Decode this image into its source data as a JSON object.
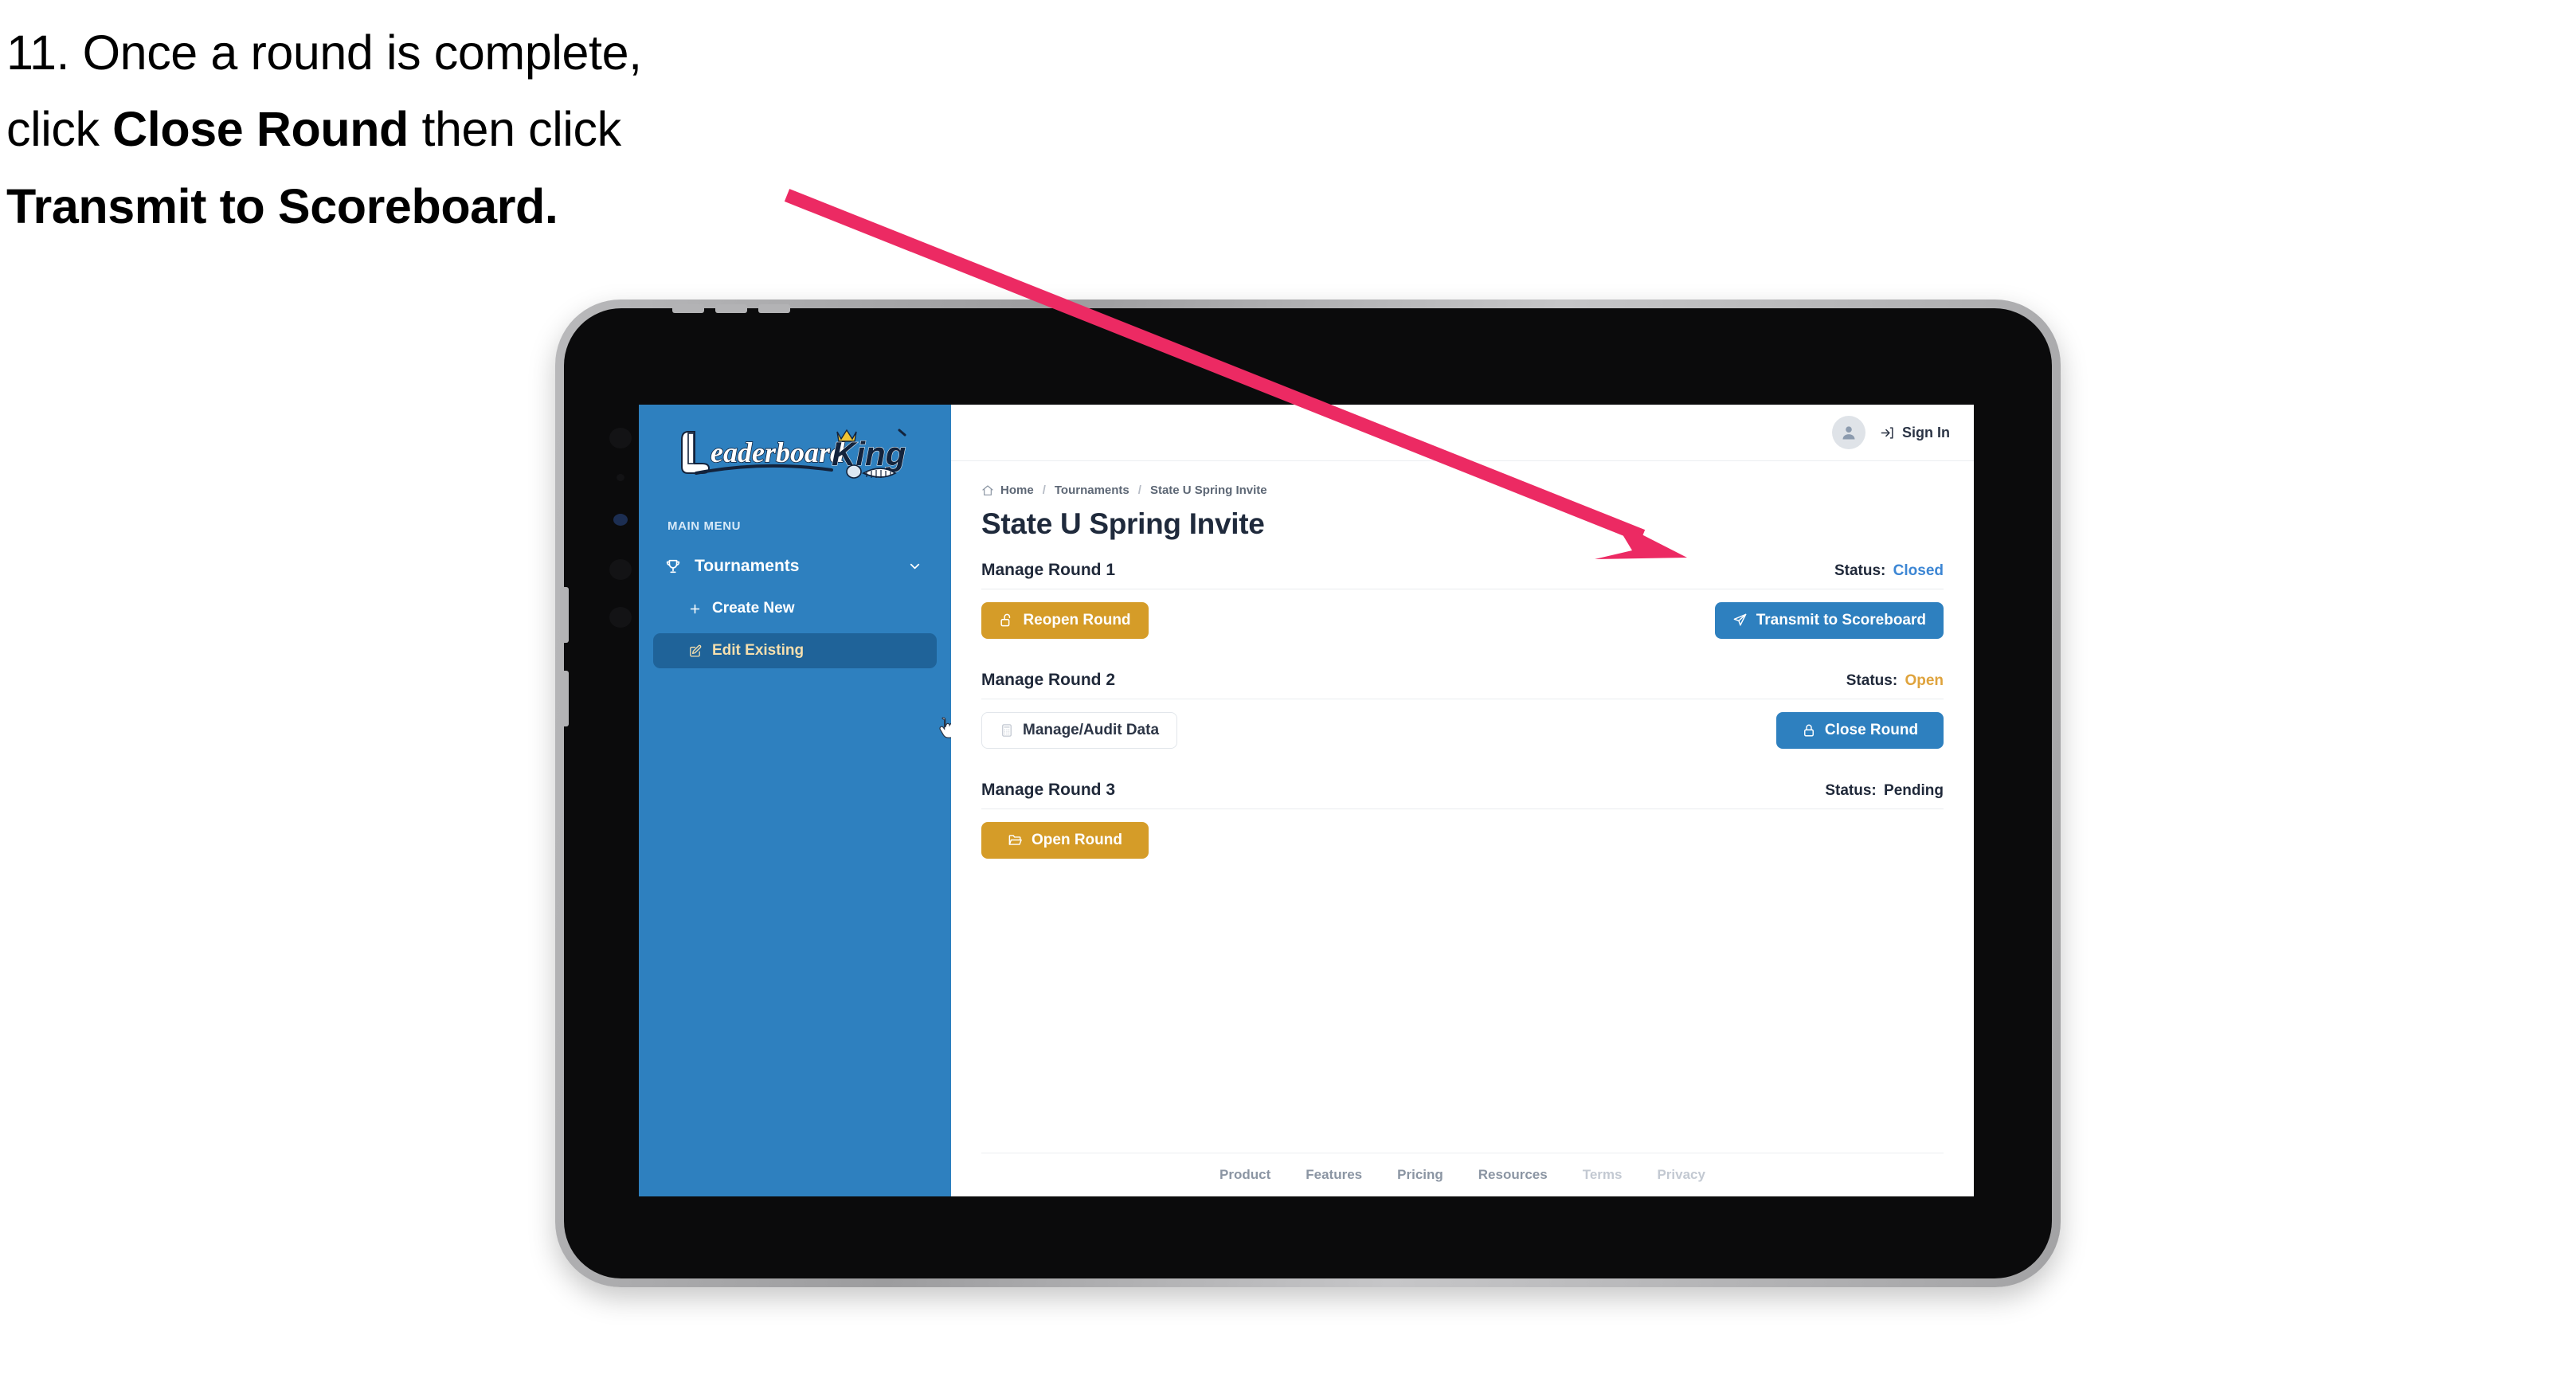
{
  "caption": {
    "line1_plain": "11. Once a round is complete,",
    "line2_pre": "click ",
    "line2_bold": "Close Round",
    "line2_post": " then click",
    "line3_bold": "Transmit to Scoreboard."
  },
  "colors": {
    "accent_blue": "#2e80bf",
    "accent_gold": "#d59c28",
    "sidebar_blue": "#2e80bf",
    "sidebar_active": "#1f6399",
    "status_closed": "#3c86d4",
    "status_open": "#dfa33c",
    "status_pending": "#20293a",
    "annotation_pink": "#ec2a63",
    "heading_navy": "#1f2a3c"
  },
  "app": {
    "sidebar": {
      "logo_primary": "Leaderboard",
      "logo_secondary": "King",
      "menu_label": "MAIN MENU",
      "items": [
        {
          "label": "Tournaments",
          "icon": "trophy-icon",
          "chevron": "chevron-down-icon",
          "active": false
        },
        {
          "label": "Create New",
          "icon": "plus-icon",
          "active": false
        },
        {
          "label": "Edit Existing",
          "icon": "edit-pencil-icon",
          "active": true
        }
      ]
    },
    "topbar": {
      "avatar_icon": "user-avatar-icon",
      "signin_label": "Sign In",
      "signin_icon": "login-arrow-icon"
    },
    "breadcrumb": {
      "home_icon": "home-icon",
      "items": [
        "Home",
        "Tournaments",
        "State U Spring Invite"
      ],
      "separator": "/"
    },
    "page_title": "State U Spring Invite",
    "rounds": [
      {
        "name": "Manage Round 1",
        "status_label": "Status:",
        "status_value": "Closed",
        "status_color": "#3c86d4",
        "left_button": {
          "label": "Reopen Round",
          "icon": "unlock-icon",
          "style": "gold"
        },
        "right_button": {
          "label": "Transmit to Scoreboard",
          "icon": "paper-plane-icon",
          "style": "blue"
        }
      },
      {
        "name": "Manage Round 2",
        "status_label": "Status:",
        "status_value": "Open",
        "status_color": "#dfa33c",
        "left_button": {
          "label": "Manage/Audit Data",
          "icon": "calculator-icon",
          "style": "ghost"
        },
        "right_button": {
          "label": "Close Round",
          "icon": "lock-icon",
          "style": "blue"
        }
      },
      {
        "name": "Manage Round 3",
        "status_label": "Status:",
        "status_value": "Pending",
        "status_color": "#20293a",
        "left_button": {
          "label": "Open Round",
          "icon": "folder-open-icon",
          "style": "gold"
        },
        "right_button": null
      }
    ],
    "footer": {
      "links": [
        {
          "label": "Product",
          "muted": false
        },
        {
          "label": "Features",
          "muted": false
        },
        {
          "label": "Pricing",
          "muted": false
        },
        {
          "label": "Resources",
          "muted": false
        },
        {
          "label": "Terms",
          "muted": true
        },
        {
          "label": "Privacy",
          "muted": true
        }
      ]
    },
    "cursor": "pointing-hand-cursor"
  }
}
